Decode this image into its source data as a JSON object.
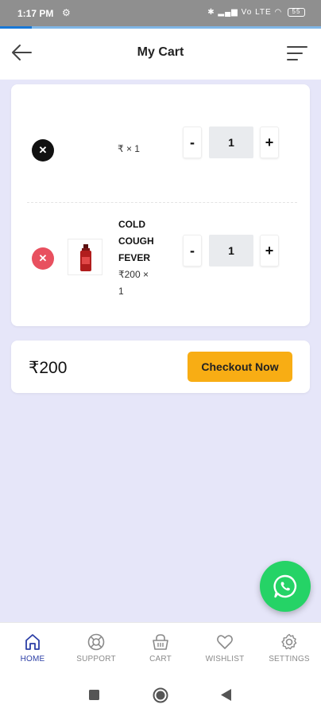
{
  "status_bar": {
    "time": "1:17 PM",
    "battery": "55",
    "signal": "Vo LTE"
  },
  "load_progress": 0.1,
  "header": {
    "title": "My Cart",
    "back_icon": "arrow-left-icon",
    "menu_icon": "hamburger-menu-icon"
  },
  "cart": {
    "items": [
      {
        "name_lines": [],
        "price_line1": "₹ × 1",
        "price_line2": "",
        "quantity": "1",
        "minus_label": "-",
        "plus_label": "+",
        "remove_icon": "close-icon"
      },
      {
        "name_lines": [
          "COLD",
          "COUGH",
          "FEVER"
        ],
        "price_line1": "₹200 ×",
        "price_line2": "1",
        "quantity": "1",
        "minus_label": "-",
        "plus_label": "+",
        "remove_icon": "close-icon",
        "thumbnail": "medicine-bottle"
      }
    ]
  },
  "summary": {
    "total": "₹200",
    "checkout_label": "Checkout Now"
  },
  "colors": {
    "accent": "#f8ad14",
    "background": "#e6e6f9",
    "active_nav": "#2c3fa6",
    "whatsapp": "#25d366",
    "remove_red": "#e8505f"
  },
  "fab": {
    "icon": "whatsapp-icon"
  },
  "bottom_nav": [
    {
      "label": "HOME",
      "icon": "home-icon",
      "active": true
    },
    {
      "label": "SUPPORT",
      "icon": "lifebuoy-icon",
      "active": false
    },
    {
      "label": "CART",
      "icon": "basket-icon",
      "active": false
    },
    {
      "label": "WISHLIST",
      "icon": "heart-icon",
      "active": false
    },
    {
      "label": "SETTINGS",
      "icon": "gear-icon",
      "active": false
    }
  ],
  "system_nav": {
    "recents_icon": "square-icon",
    "home_icon": "circle-icon",
    "back_icon": "triangle-back-icon"
  }
}
